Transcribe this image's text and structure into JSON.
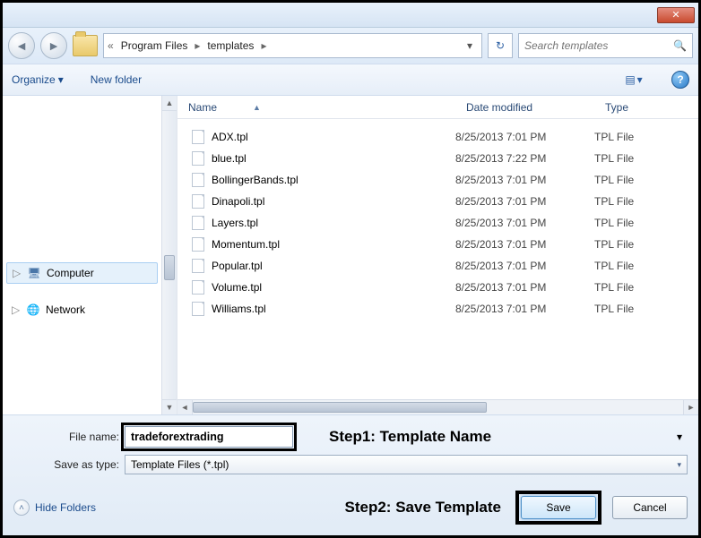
{
  "titlebar": {
    "close": "✕"
  },
  "nav": {
    "back": "◄",
    "forward": "►",
    "breadcrumb": {
      "pre": "«",
      "seg1": "Program Files",
      "seg2": "templates"
    },
    "refresh": "↻",
    "search_placeholder": "Search templates",
    "search_icon": "🔍"
  },
  "toolbar": {
    "organize": "Organize",
    "newfolder": "New folder",
    "view_icon": "☰",
    "help_icon": "?"
  },
  "tree": {
    "computer": "Computer",
    "network": "Network"
  },
  "columns": {
    "name": "Name",
    "date": "Date modified",
    "type": "Type"
  },
  "files": [
    {
      "name": "ADX.tpl",
      "date": "8/25/2013 7:01 PM",
      "type": "TPL File"
    },
    {
      "name": "blue.tpl",
      "date": "8/25/2013 7:22 PM",
      "type": "TPL File"
    },
    {
      "name": "BollingerBands.tpl",
      "date": "8/25/2013 7:01 PM",
      "type": "TPL File"
    },
    {
      "name": "Dinapoli.tpl",
      "date": "8/25/2013 7:01 PM",
      "type": "TPL File"
    },
    {
      "name": "Layers.tpl",
      "date": "8/25/2013 7:01 PM",
      "type": "TPL File"
    },
    {
      "name": "Momentum.tpl",
      "date": "8/25/2013 7:01 PM",
      "type": "TPL File"
    },
    {
      "name": "Popular.tpl",
      "date": "8/25/2013 7:01 PM",
      "type": "TPL File"
    },
    {
      "name": "Volume.tpl",
      "date": "8/25/2013 7:01 PM",
      "type": "TPL File"
    },
    {
      "name": "Williams.tpl",
      "date": "8/25/2013 7:01 PM",
      "type": "TPL File"
    }
  ],
  "form": {
    "filename_label": "File name:",
    "filename_value": "tradeforextrading",
    "savetype_label": "Save as type:",
    "savetype_value": "Template Files (*.tpl)"
  },
  "annotations": {
    "step1": "Step1: Template Name",
    "step2": "Step2: Save Template"
  },
  "buttons": {
    "hide_folders": "Hide Folders",
    "save": "Save",
    "cancel": "Cancel"
  }
}
